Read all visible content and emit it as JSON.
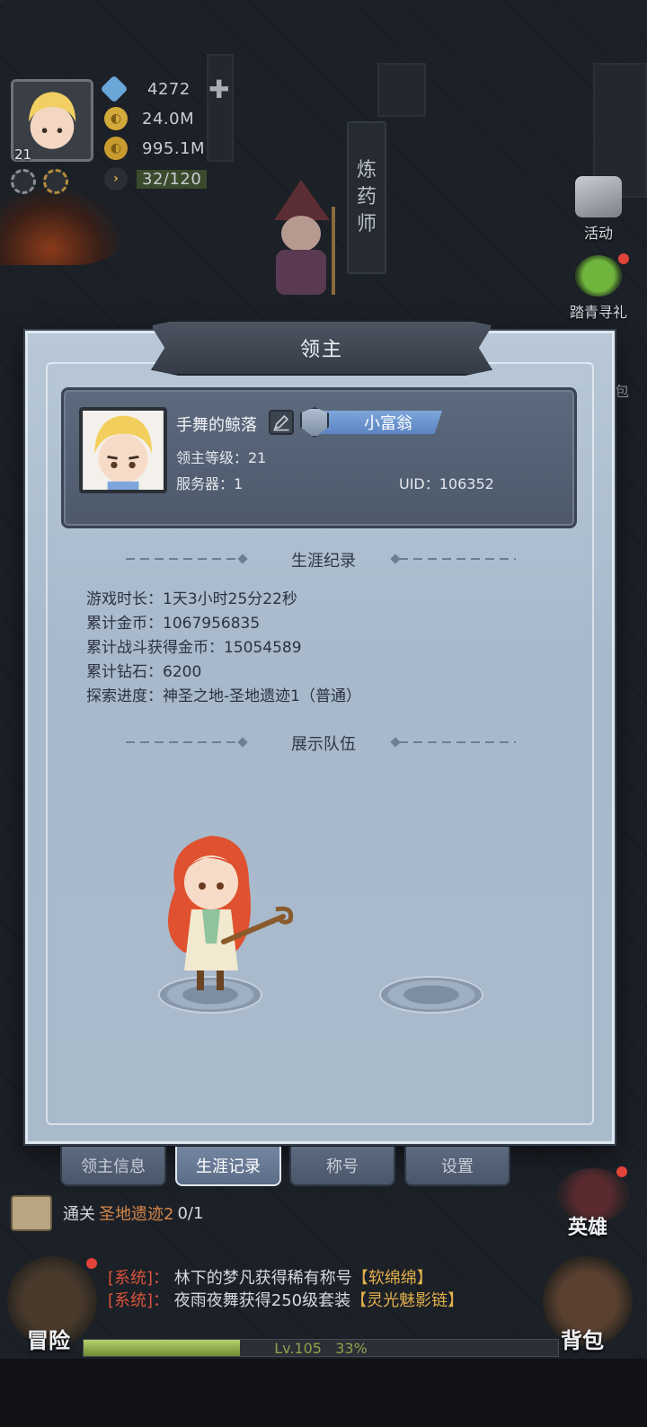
{
  "hud": {
    "level": "21",
    "diamonds": "4272",
    "gold": "24.0M",
    "coins": "995.1M",
    "stamina": "32/120"
  },
  "scene": {
    "alchemist_sign": [
      "炼",
      "药",
      "师"
    ]
  },
  "side_buttons": {
    "activity": "活动",
    "spring_gift": "踏青寻礼",
    "bag_partial": "包"
  },
  "modal": {
    "title": "领主",
    "profile": {
      "name": "手舞的鲸落",
      "title_badge": "小富翁",
      "lord_level": "领主等级：21",
      "server": "服务器：1",
      "uid": "UID：106352"
    },
    "career": {
      "section_title": "生涯纪录",
      "stats": [
        "游戏时长：1天3小时25分22秒",
        "累计金币：1067956835",
        "累计战斗获得金币：15054589",
        "累计钻石：6200",
        "探索进度：神圣之地-圣地遗迹1（普通）"
      ]
    },
    "team": {
      "section_title": "展示队伍"
    },
    "tabs": [
      "领主信息",
      "生涯记录",
      "称号",
      "设置"
    ],
    "active_tab": 1
  },
  "bottom": {
    "quest_prefix": "通关",
    "quest_target": "圣地遗迹2",
    "quest_progress": "0/1",
    "heroes_label": "英雄",
    "adventure_label": "冒险",
    "backpack_label": "背包",
    "chat": [
      {
        "tag": "[系统]",
        "sep": "：",
        "text": "林下的梦凡获得稀有称号",
        "highlight": "【软绵绵】"
      },
      {
        "tag": "[系统]",
        "sep": "：",
        "text": "夜雨夜舞获得250级套装",
        "highlight": "【灵光魅影链】"
      }
    ],
    "xp_level": "Lv.105",
    "xp_percent": "33%",
    "xp_fraction": 0.33
  },
  "colors": {
    "panel": "#a9bacb",
    "card": "#4d596b",
    "accent_gold": "#e1b04b",
    "system_red": "#d9553b"
  }
}
